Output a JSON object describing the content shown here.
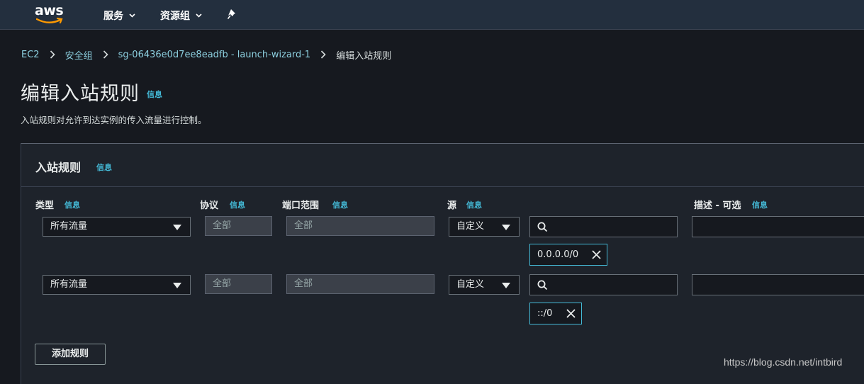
{
  "nav": {
    "logo": "aws",
    "services": "服务",
    "resource_groups": "资源组",
    "pin_icon": "pin-icon"
  },
  "breadcrumb": {
    "items": [
      "EC2",
      "安全组",
      "sg-06436e0d7ee8eadfb - launch-wizard-1"
    ],
    "current": "编辑入站规则"
  },
  "page": {
    "title": "编辑入站规则",
    "info": "信息",
    "description": "入站规则对允许到达实例的传入流量进行控制。"
  },
  "panel": {
    "title": "入站规则",
    "info": "信息",
    "columns": {
      "type": "类型",
      "protocol": "协议",
      "port_range": "端口范围",
      "source": "源",
      "description": "描述 - 可选"
    },
    "rules": [
      {
        "type": "所有流量",
        "protocol": "全部",
        "port_range": "全部",
        "source_type": "自定义",
        "search_value": "",
        "cidr": "0.0.0.0/0",
        "description": ""
      },
      {
        "type": "所有流量",
        "protocol": "全部",
        "port_range": "全部",
        "source_type": "自定义",
        "search_value": "",
        "cidr": "::/0",
        "description": ""
      }
    ],
    "add_rule": "添加规则"
  },
  "watermark": "https://blog.csdn.net/intbird",
  "colors": {
    "background": "#16191f",
    "nav": "#232f3e",
    "link": "#44b9d6",
    "logo_smile": "#ff9900"
  }
}
